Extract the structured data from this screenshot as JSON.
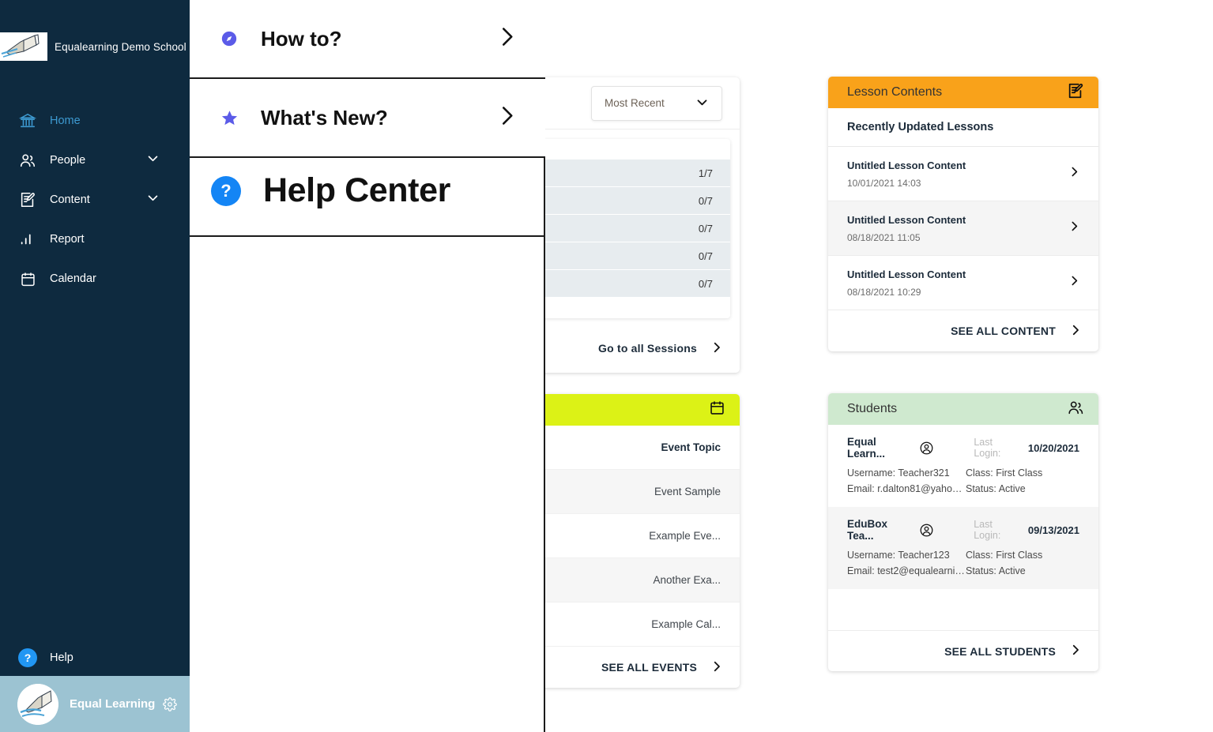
{
  "sidebar": {
    "brand": "Equalearning Demo School",
    "nav": [
      {
        "label": "Home",
        "icon": "bank-icon",
        "active": true,
        "caret": false
      },
      {
        "label": "People",
        "icon": "people-icon",
        "active": false,
        "caret": true
      },
      {
        "label": "Content",
        "icon": "content-edit-icon",
        "active": false,
        "caret": true
      },
      {
        "label": "Report",
        "icon": "bar-chart-icon",
        "active": false,
        "caret": false
      },
      {
        "label": "Calendar",
        "icon": "calendar-icon",
        "active": false,
        "caret": false
      }
    ],
    "help_label": "Help",
    "help_badge": "?",
    "user_name": "Equal Learning"
  },
  "help_panel": {
    "title": "Help Center",
    "title_badge": "?",
    "close_icon": "close-icon",
    "items": [
      {
        "label": "How to?",
        "icon": "compass-icon"
      },
      {
        "label": "What's New?",
        "icon": "star-icon"
      }
    ]
  },
  "sessions": {
    "sort_value": "Most Recent",
    "bars": [
      "1/7",
      "0/7",
      "0/7",
      "0/7",
      "0/7"
    ],
    "footer": "Go to all Sessions"
  },
  "events": {
    "header_icon": "calendar-icon",
    "column_header": "Event Topic",
    "rows": [
      "Event Sample",
      "Example Eve...",
      "Another Exa...",
      "Example Cal..."
    ],
    "footer": "SEE ALL EVENTS"
  },
  "lesson_contents": {
    "title": "Lesson Contents",
    "header_icon": "content-edit-icon",
    "subtitle": "Recently Updated Lessons",
    "rows": [
      {
        "title": "Untitled Lesson Content",
        "date": "10/01/2021 14:03"
      },
      {
        "title": "Untitled Lesson Content",
        "date": "08/18/2021 11:05"
      },
      {
        "title": "Untitled Lesson Content",
        "date": "08/18/2021 10:29"
      }
    ],
    "footer": "SEE ALL CONTENT"
  },
  "students": {
    "title": "Students",
    "header_icon": "people-icon",
    "last_login_label": "Last Login:",
    "rows": [
      {
        "name": "Equal Learn...",
        "last_login": "10/20/2021",
        "username": "Username: Teacher321",
        "class": "Class: First Class",
        "email": "Email: r.dalton81@yahoo....",
        "status": "Status: Active"
      },
      {
        "name": "EduBox Tea...",
        "last_login": "09/13/2021",
        "username": "Username: Teacher123",
        "class": "Class: First Class",
        "email": "Email: test2@equalearnin...",
        "status": "Status: Active"
      }
    ],
    "footer": "SEE ALL STUDENTS"
  },
  "colors": {
    "sidebar": "#0e2a3f",
    "accent_blue": "#3d9ad1",
    "orange": "#f9a21a",
    "green": "#cfe9cf",
    "yellow": "#dcf216",
    "purple": "#5b5be8",
    "user_bar": "#9cc3d2"
  }
}
